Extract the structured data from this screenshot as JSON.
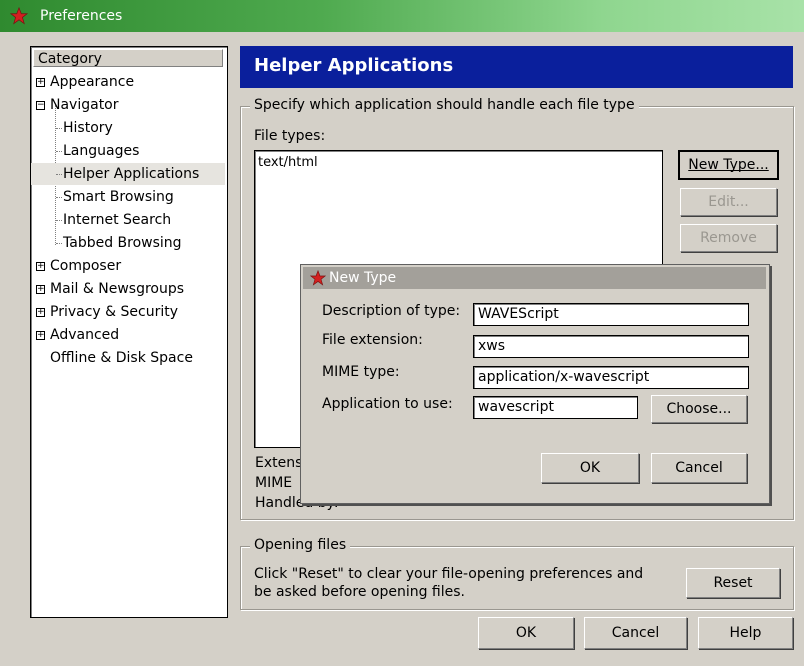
{
  "window": {
    "title": "Preferences"
  },
  "sidebar": {
    "header": "Category",
    "items": [
      {
        "label": "Appearance",
        "expander": "+"
      },
      {
        "label": "Navigator",
        "expander": "−"
      },
      {
        "label": "History"
      },
      {
        "label": "Languages"
      },
      {
        "label": "Helper Applications",
        "selected": true
      },
      {
        "label": "Smart Browsing"
      },
      {
        "label": "Internet Search"
      },
      {
        "label": "Tabbed Browsing"
      },
      {
        "label": "Composer",
        "expander": "+"
      },
      {
        "label": "Mail & Newsgroups",
        "expander": "+"
      },
      {
        "label": "Privacy & Security",
        "expander": "+"
      },
      {
        "label": "Advanced",
        "expander": "+"
      },
      {
        "label": "Offline & Disk Space"
      }
    ]
  },
  "panel": {
    "title": "Helper Applications",
    "group_legend": "Specify which application should handle each file type",
    "file_types_label": "File types:",
    "file_types": [
      "text/html"
    ],
    "buttons": {
      "new_type": "New Type...",
      "edit": "Edit...",
      "remove": "Remove"
    },
    "details": {
      "extension": "Extens",
      "mime": "MIME",
      "handled": "Handled by:"
    },
    "opening": {
      "legend": "Opening files",
      "text_line1": "Click \"Reset\" to clear your file-opening preferences and",
      "text_line2": "be asked before opening files.",
      "reset": "Reset"
    }
  },
  "dialog": {
    "title": "New Type",
    "fields": {
      "description_label": "Description of type:",
      "description_value": "WAVEScript",
      "extension_label": "File extension:",
      "extension_value": "xws",
      "mime_label": "MIME type:",
      "mime_value": "application/x-wavescript",
      "app_label": "Application to use:",
      "app_value": "wavescript"
    },
    "choose": "Choose...",
    "ok": "OK",
    "cancel": "Cancel"
  },
  "footer": {
    "ok": "OK",
    "cancel": "Cancel",
    "help": "Help"
  },
  "colors": {
    "banner": "#0a1f9c",
    "titlebar": "#4faa4f",
    "accent_star": "#d42020"
  }
}
